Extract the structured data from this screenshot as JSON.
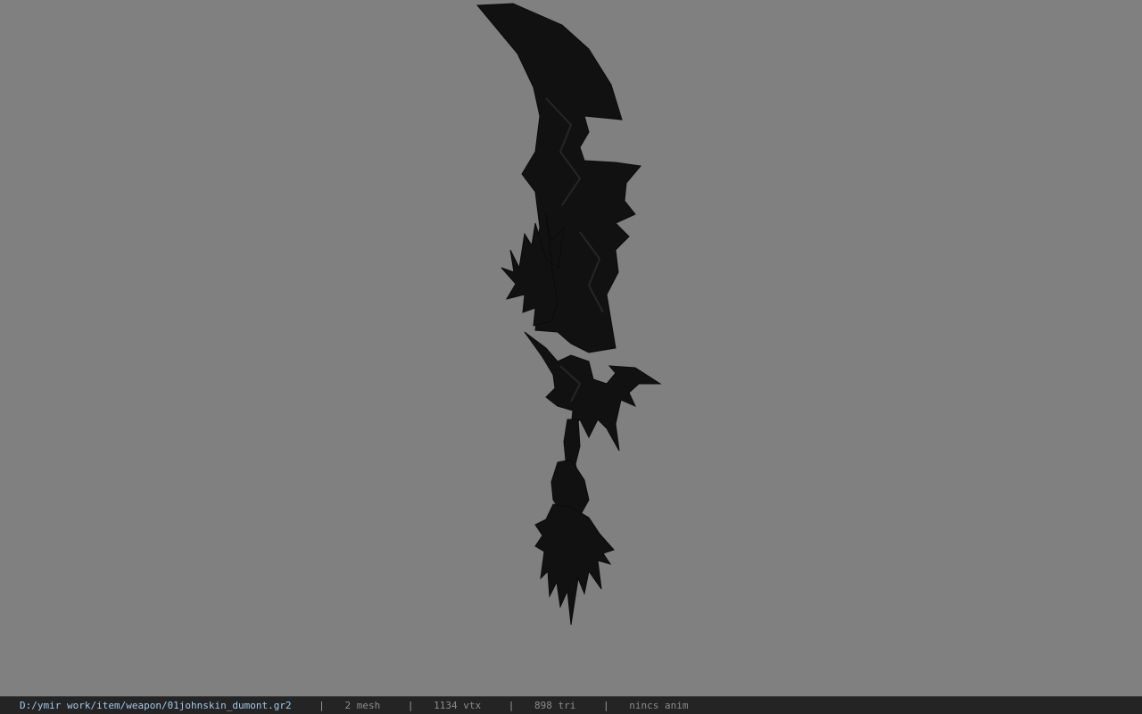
{
  "viewport": {
    "background": "#808080",
    "model_color": "#111111",
    "model": "weapon-mesh"
  },
  "status": {
    "file_path": "D:/ymir work/item/weapon/01johnskin_dumont.gr2",
    "separator": "|",
    "mesh": "2 mesh",
    "vertices": "1134 vtx",
    "triangles": "898 tri",
    "anim": "nincs anim"
  },
  "colors": {
    "statusbar_bg": "#242424",
    "path_text": "#9fc9e8",
    "stat_text": "#8c8c8c"
  }
}
